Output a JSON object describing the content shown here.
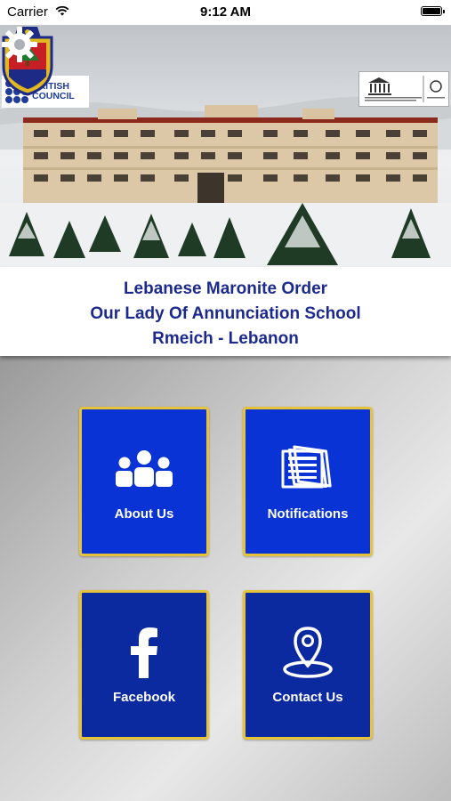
{
  "status_bar": {
    "carrier": "Carrier",
    "time": "9:12 AM"
  },
  "header": {
    "british_council": "BRITISH COUNCIL",
    "title_lines": [
      "Lebanese Maronite Order",
      "Our Lady Of Annunciation School",
      "Rmeich - Lebanon"
    ]
  },
  "menu": {
    "tiles": [
      {
        "label": "About Us",
        "icon": "group-icon"
      },
      {
        "label": "Notifications",
        "icon": "newspaper-icon"
      },
      {
        "label": "Facebook",
        "icon": "facebook-icon"
      },
      {
        "label": "Contact Us",
        "icon": "location-pin-icon"
      }
    ]
  },
  "colors": {
    "title_text": "#1c2a8e",
    "tile_blue": "#0a33d6",
    "tile_dark_blue": "#0b2aa0",
    "tile_border": "#e7c33a"
  }
}
